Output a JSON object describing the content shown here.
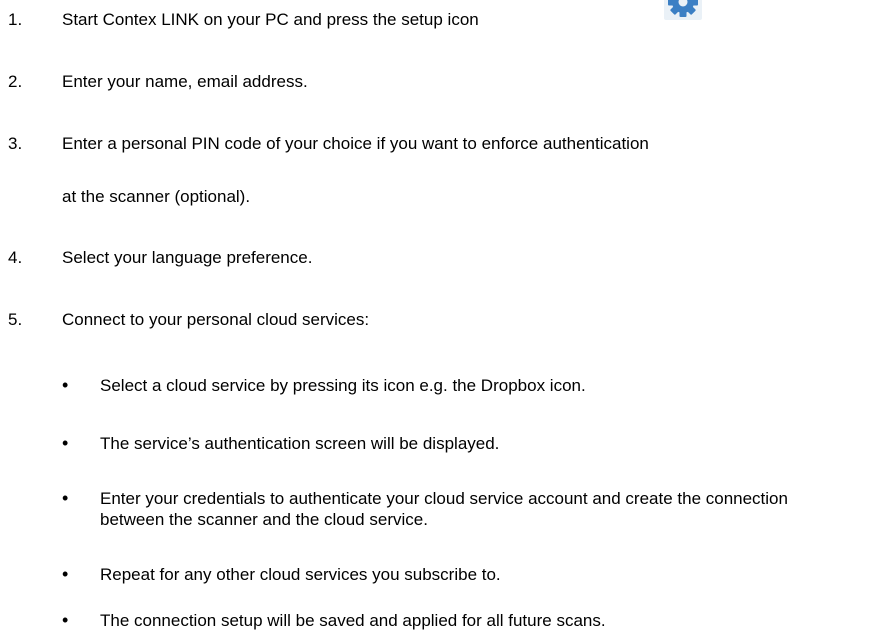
{
  "steps": [
    {
      "num": "1.",
      "text": "Start Contex LINK on your PC and press the setup icon",
      "icon": "gear-icon"
    },
    {
      "num": "2.",
      "text": "Enter your name, email address."
    },
    {
      "num": "3.",
      "text": "Enter a personal PIN code of your choice if you want to enforce authentication",
      "continuation": "at the scanner (optional)."
    },
    {
      "num": "4.",
      "text": "Select your language preference."
    },
    {
      "num": "5.",
      "text": "Connect to your personal cloud services:"
    }
  ],
  "bullets": [
    "Select a cloud service by pressing its icon e.g. the Dropbox icon.",
    "The service’s authentication screen will be displayed.",
    "Enter your credentials to authenticate your cloud service account and create the connection between the scanner and the cloud service.",
    "Repeat for any other cloud services you subscribe to.",
    "The connection setup will be saved and applied for all future scans."
  ],
  "bullet_symbol": "•",
  "colors": {
    "gear": "#3b7fc4",
    "gear_bg": "#eaf1f7"
  }
}
